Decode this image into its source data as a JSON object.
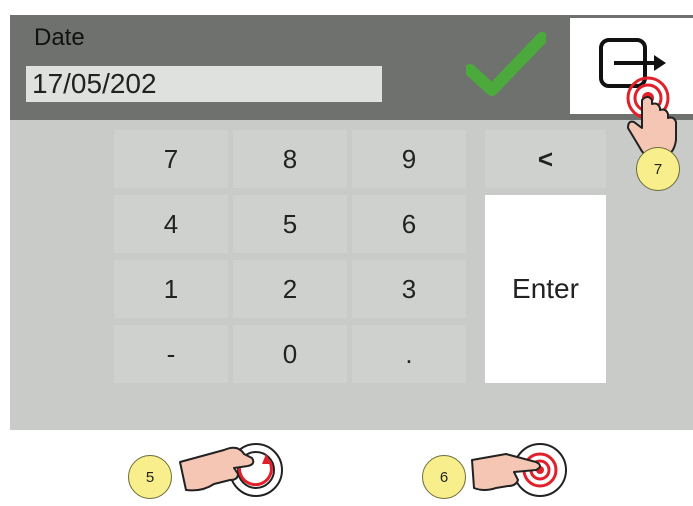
{
  "date": {
    "label": "Date",
    "value": "17/05/202"
  },
  "keypad": {
    "k7": "7",
    "k8": "8",
    "k9": "9",
    "back": "<",
    "k4": "4",
    "k5": "5",
    "k6": "6",
    "k1": "1",
    "k2": "2",
    "k3": "3",
    "enter": "Enter",
    "minus": "-",
    "k0": "0",
    "dot": "."
  },
  "callouts": {
    "c5": "5",
    "c6": "6",
    "c7": "7"
  },
  "colors": {
    "header": "#6f716f",
    "panel": "#c9cbc9",
    "confirm": "#4caa3c",
    "badge": "#f8ef8c",
    "touch": "#e0202a"
  },
  "icons": [
    "check-icon",
    "exit-icon",
    "tap-hand-icon",
    "rotate-knob-hand-icon",
    "press-knob-hand-icon"
  ]
}
